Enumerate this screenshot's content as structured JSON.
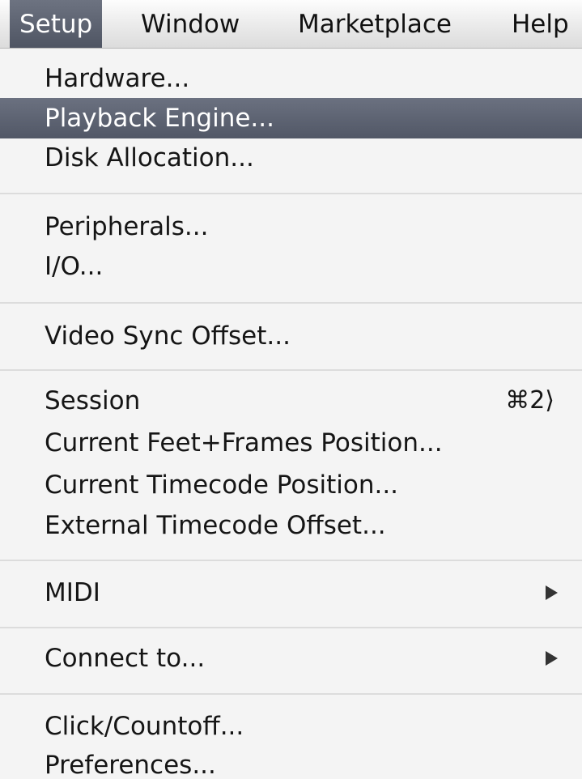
{
  "menubar": {
    "items": [
      {
        "label": "Setup",
        "active": true
      },
      {
        "label": "Window",
        "active": false
      },
      {
        "label": "Marketplace",
        "active": false
      },
      {
        "label": "Help",
        "active": false
      }
    ]
  },
  "menu": {
    "hardware": "Hardware...",
    "playback_engine": "Playback Engine...",
    "disk_allocation": "Disk Allocation...",
    "peripherals": "Peripherals...",
    "io": "I/O...",
    "video_sync_offset": "Video Sync Offset...",
    "session": "Session",
    "session_shortcut": "⌘2⟩",
    "current_feet_frames": "Current Feet+Frames Position...",
    "current_timecode": "Current Timecode Position...",
    "external_timecode_offset": "External Timecode Offset...",
    "midi": "MIDI",
    "connect_to": "Connect to...",
    "click_countoff": "Click/Countoff...",
    "preferences": "Preferences..."
  },
  "highlighted_item": "playback_engine",
  "icons": {
    "submenu": "chevron-right-icon",
    "command": "command-key-icon"
  },
  "colors": {
    "highlight": "#5d6372",
    "menu_background": "#f4f4f4",
    "separator": "#dcdcdc"
  }
}
